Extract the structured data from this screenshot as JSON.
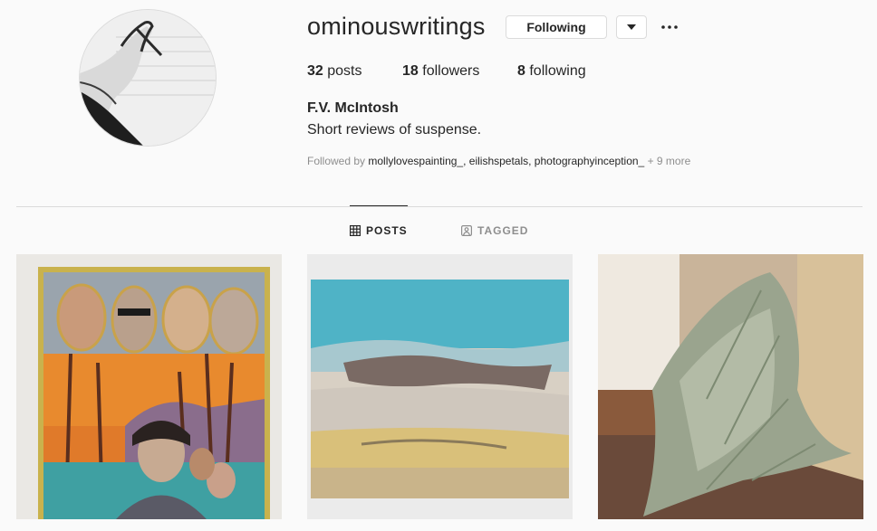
{
  "profile": {
    "username": "ominouswritings",
    "following_label": "Following",
    "full_name": "F.V. McIntosh",
    "bio": "Short reviews of suspense."
  },
  "stats": {
    "posts_count": "32",
    "posts_label": "posts",
    "followers_count": "18",
    "followers_label": "followers",
    "following_count": "8",
    "following_label": "following"
  },
  "followed_by": {
    "prefix": "Followed by",
    "names": "mollylovespainting_, eilishspetals, photographyinception_",
    "more": "+ 9 more"
  },
  "tabs": {
    "posts": "POSTS",
    "tagged": "TAGGED"
  },
  "icons": {
    "dropdown": "caret-down-icon",
    "more": "more-options-icon",
    "posts_tab": "grid-icon",
    "tagged_tab": "tag-person-icon"
  },
  "colors": {
    "text": "#262626",
    "muted": "#8e8e8e",
    "border": "#dbdbdb",
    "background": "#fafafa"
  }
}
